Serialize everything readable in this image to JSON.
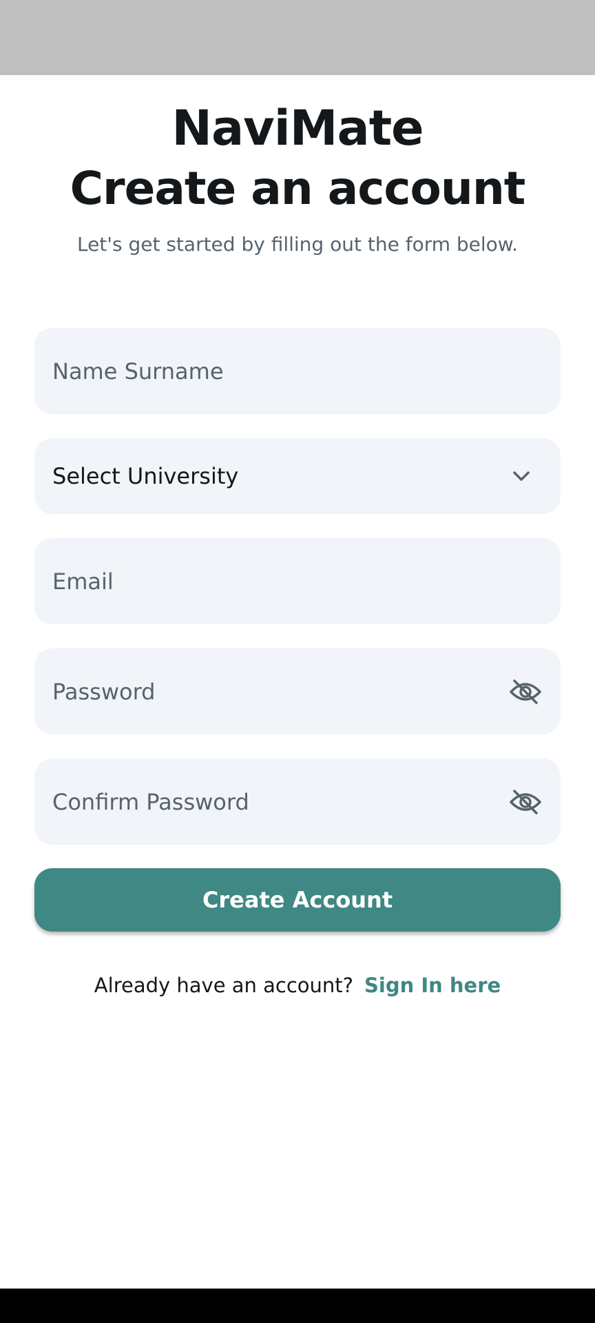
{
  "header": {
    "app_name": "NaviMate",
    "title": "Create an account",
    "subtitle": "Let's get started by filling out the form below."
  },
  "form": {
    "name": {
      "placeholder": "Name Surname",
      "value": ""
    },
    "university": {
      "selected": "Select University",
      "icon": "chevron-down-icon"
    },
    "email": {
      "placeholder": "Email",
      "value": ""
    },
    "password": {
      "placeholder": "Password",
      "value": "",
      "icon": "eye-off-icon"
    },
    "confirm_password": {
      "placeholder": "Confirm Password",
      "value": "",
      "icon": "eye-off-icon"
    },
    "submit_label": "Create Account"
  },
  "footer": {
    "prompt": "Already have an account?",
    "link_label": "Sign In here"
  },
  "colors": {
    "accent": "#3f8883",
    "field_bg": "#f1f4f8",
    "text_primary": "#14181b",
    "text_secondary": "#57636c"
  }
}
